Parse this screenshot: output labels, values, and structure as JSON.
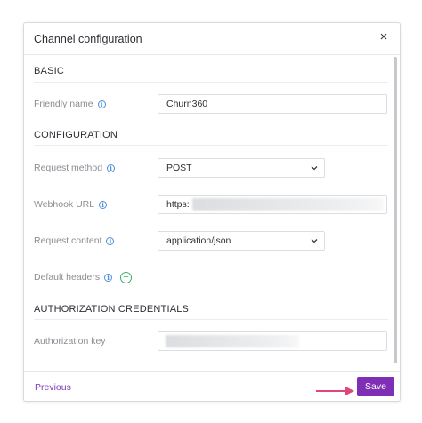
{
  "dialog": {
    "title": "Channel configuration",
    "close_glyph": "×"
  },
  "sections": {
    "basic": "BASIC",
    "configuration": "CONFIGURATION",
    "authorization": "AUTHORIZATION CREDENTIALS"
  },
  "fields": {
    "friendly_name": {
      "label": "Friendly name",
      "value": "Churn360"
    },
    "request_method": {
      "label": "Request method",
      "value": "POST"
    },
    "webhook_url": {
      "label": "Webhook URL",
      "value": "https:"
    },
    "request_content": {
      "label": "Request content",
      "value": "application/json"
    },
    "default_headers": {
      "label": "Default headers",
      "add_glyph": "+"
    },
    "authorization_key": {
      "label": "Authorization key"
    }
  },
  "footer": {
    "previous": "Previous",
    "save": "Save"
  },
  "icons": {
    "info": "info-icon",
    "close": "close-icon",
    "chevron": "chevron-down-icon",
    "add": "plus-circle-icon",
    "arrow": "arrow-right-icon"
  },
  "colors": {
    "accent": "#7e2fb5",
    "info": "#4f8fd9",
    "add": "#3fae6e",
    "annotation_arrow": "#e0457b"
  }
}
